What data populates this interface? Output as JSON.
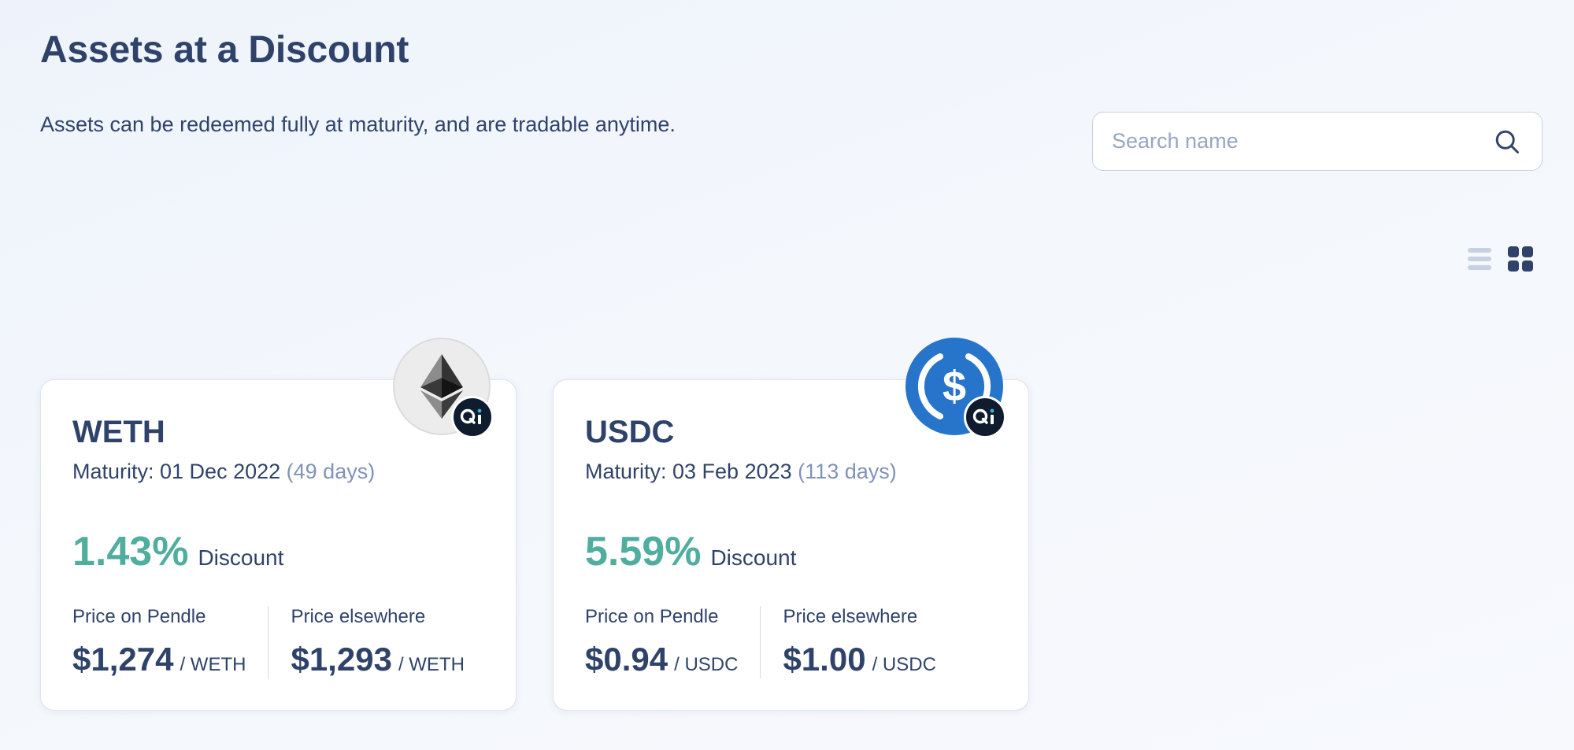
{
  "header": {
    "title": "Assets at a Discount",
    "subtitle": "Assets can be redeemed fully at maturity, and are tradable anytime."
  },
  "search": {
    "placeholder": "Search name",
    "value": ""
  },
  "view_toggle": {
    "options": [
      "list",
      "grid"
    ],
    "selected": "grid"
  },
  "colors": {
    "text": "#2f436a",
    "muted": "#7f93b8",
    "discount": "#4fae9e",
    "eth_logo_bg": "#ececec",
    "usdc_logo_bg": "#2775ca",
    "qi_badge_bg": "#0e1c2d"
  },
  "assets": [
    {
      "name": "WETH",
      "icon": "ethereum-icon",
      "badge_icon": "qi-dao-icon",
      "maturity_label": "Maturity: 01 Dec 2022",
      "days_label": "(49 days)",
      "discount_value": "1.43%",
      "discount_label": "Discount",
      "price_pendle_label": "Price on Pendle",
      "price_pendle": "$1,274",
      "price_pendle_unit": "/ WETH",
      "price_elsewhere_label": "Price elsewhere",
      "price_elsewhere": "$1,293",
      "price_elsewhere_unit": "/ WETH"
    },
    {
      "name": "USDC",
      "icon": "usdc-icon",
      "badge_icon": "qi-dao-icon",
      "maturity_label": "Maturity: 03 Feb 2023",
      "days_label": "(113 days)",
      "discount_value": "5.59%",
      "discount_label": "Discount",
      "price_pendle_label": "Price on Pendle",
      "price_pendle": "$0.94",
      "price_pendle_unit": "/ USDC",
      "price_elsewhere_label": "Price elsewhere",
      "price_elsewhere": "$1.00",
      "price_elsewhere_unit": "/ USDC"
    }
  ]
}
